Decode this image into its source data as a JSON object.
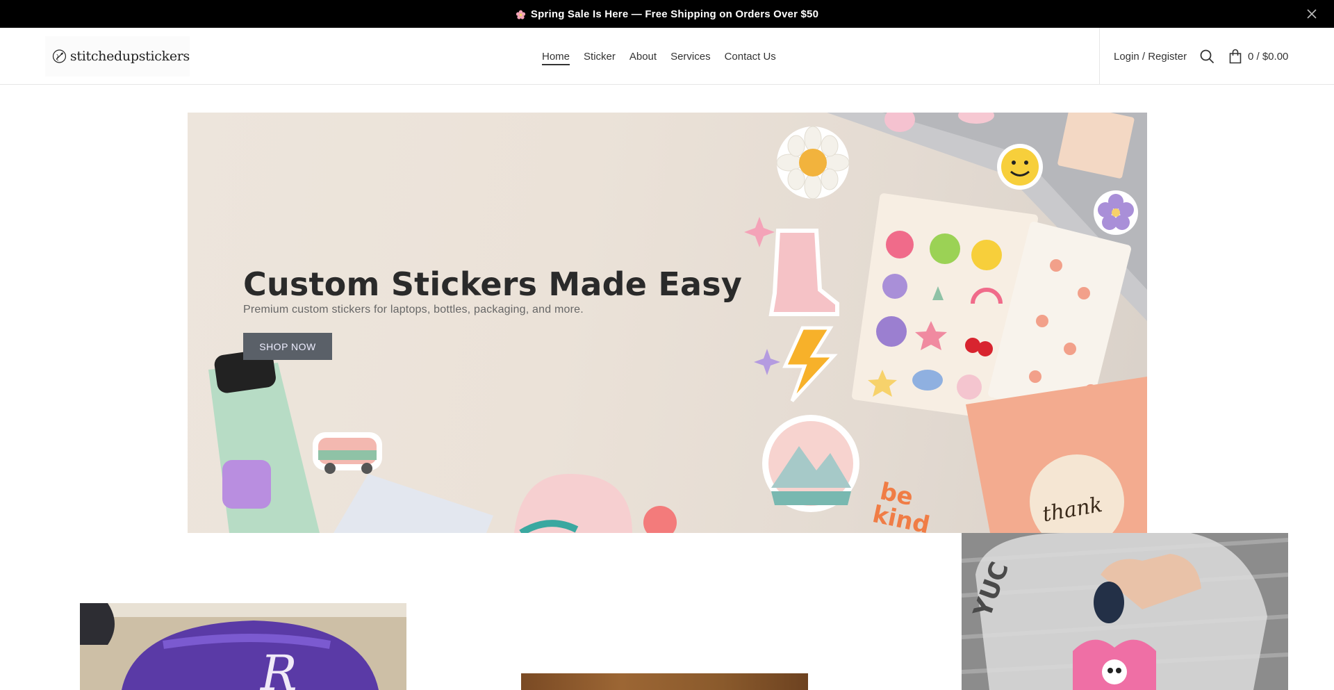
{
  "announcement": {
    "text": "Spring Sale Is Here — Free Shipping on Orders Over $50",
    "icon": "flower-icon"
  },
  "header": {
    "logo_text": "stitchedupstickers",
    "nav": [
      {
        "label": "Home",
        "active": true
      },
      {
        "label": "Sticker",
        "active": false
      },
      {
        "label": "About",
        "active": false
      },
      {
        "label": "Services",
        "active": false
      },
      {
        "label": "Contact Us",
        "active": false
      }
    ],
    "account_label": "Login / Register",
    "cart_label": "0 / $0.00"
  },
  "hero": {
    "title": "Custom Stickers Made Easy",
    "subtitle": "Premium custom stickers for laptops, bottles, packaging, and more.",
    "button_label": "SHOP NOW",
    "button_color": "#5a6068"
  },
  "colors": {
    "announcement_bg": "#000000",
    "nav_text": "#333333",
    "hero_bg": "#ebe2d8"
  }
}
